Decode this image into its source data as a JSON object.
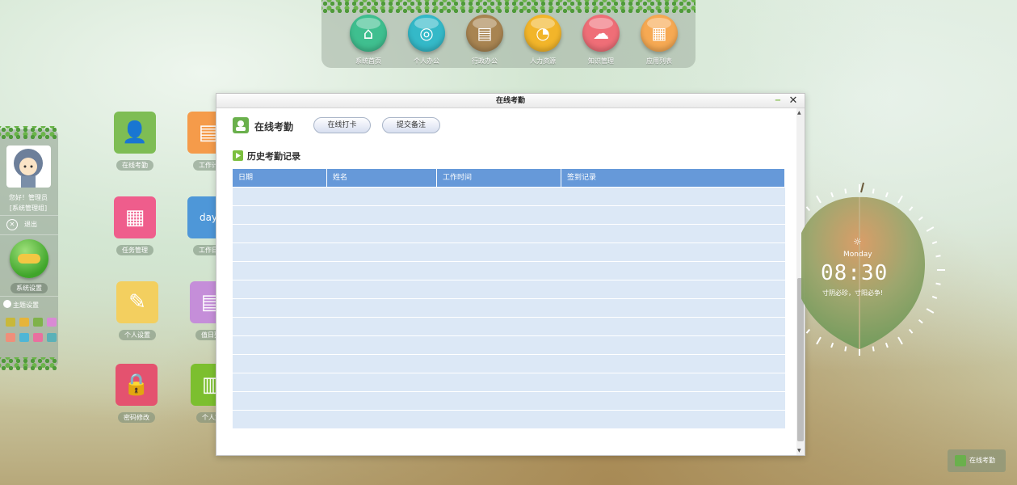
{
  "dock": {
    "items": [
      {
        "label": "系统首页",
        "color": "#3fbf8f",
        "glyph": "⌂",
        "icon": "home-icon"
      },
      {
        "label": "个人办公",
        "color": "#34b9c8",
        "glyph": "◎",
        "icon": "person-circle-icon"
      },
      {
        "label": "行政办公",
        "color": "#a88451",
        "glyph": "▤",
        "icon": "archive-icon"
      },
      {
        "label": "人力资源",
        "color": "#f2b52a",
        "glyph": "◔",
        "icon": "pie-icon"
      },
      {
        "label": "知识管理",
        "color": "#ef6e77",
        "glyph": "☁",
        "icon": "cloud-upload-icon"
      },
      {
        "label": "应用列表",
        "color": "#f6a953",
        "glyph": "▦",
        "icon": "grid-icon"
      }
    ]
  },
  "user": {
    "greeting": "您好！管理员",
    "group": "[系统管理组]",
    "logout": "退出",
    "settings": "系统设置",
    "theme": "主题设置",
    "swatches": [
      "#c8b83a",
      "#e6b43a",
      "#7fb24a",
      "#d98ad4",
      "#ef8f7a",
      "#4fb6d6",
      "#e9709f",
      "#5ab1b8"
    ]
  },
  "desktop_icons": [
    {
      "label": "在线考勤",
      "color": "#7ebd54",
      "glyph": "👤",
      "icon": "attendance-user-icon"
    },
    {
      "label": "任务管理",
      "color": "#ef5d8c",
      "glyph": "▦",
      "icon": "task-grid-icon"
    },
    {
      "label": "个人设置",
      "color": "#f3cf5f",
      "glyph": "✎",
      "icon": "edit-icon"
    },
    {
      "label": "密码修改",
      "color": "#e4526f",
      "glyph": "🔒",
      "icon": "lock-icon"
    },
    {
      "label": "工作计",
      "color": "#f59b4a",
      "glyph": "▤",
      "icon": "notepad-icon"
    },
    {
      "label": "工作日",
      "color": "#4e97d8",
      "glyph": "day",
      "icon": "calendar-icon"
    },
    {
      "label": "值日列",
      "color": "#c58ed9",
      "glyph": "▤",
      "icon": "roster-icon"
    },
    {
      "label": "个人文",
      "color": "#7cbf2f",
      "glyph": "▥",
      "icon": "document-icon"
    }
  ],
  "window": {
    "title": "在线考勤",
    "heading": "在线考勤",
    "btn_punch": "在线打卡",
    "btn_note": "提交备注",
    "section": "历史考勤记录",
    "columns": [
      "日期",
      "姓名",
      "工作时间",
      "签到记录"
    ],
    "row_count": 13
  },
  "clock": {
    "day": "Monday",
    "time": "08:30",
    "motto": "寸阴必珍，寸阳必争!"
  },
  "taskbar": {
    "label": "在线考勤"
  }
}
